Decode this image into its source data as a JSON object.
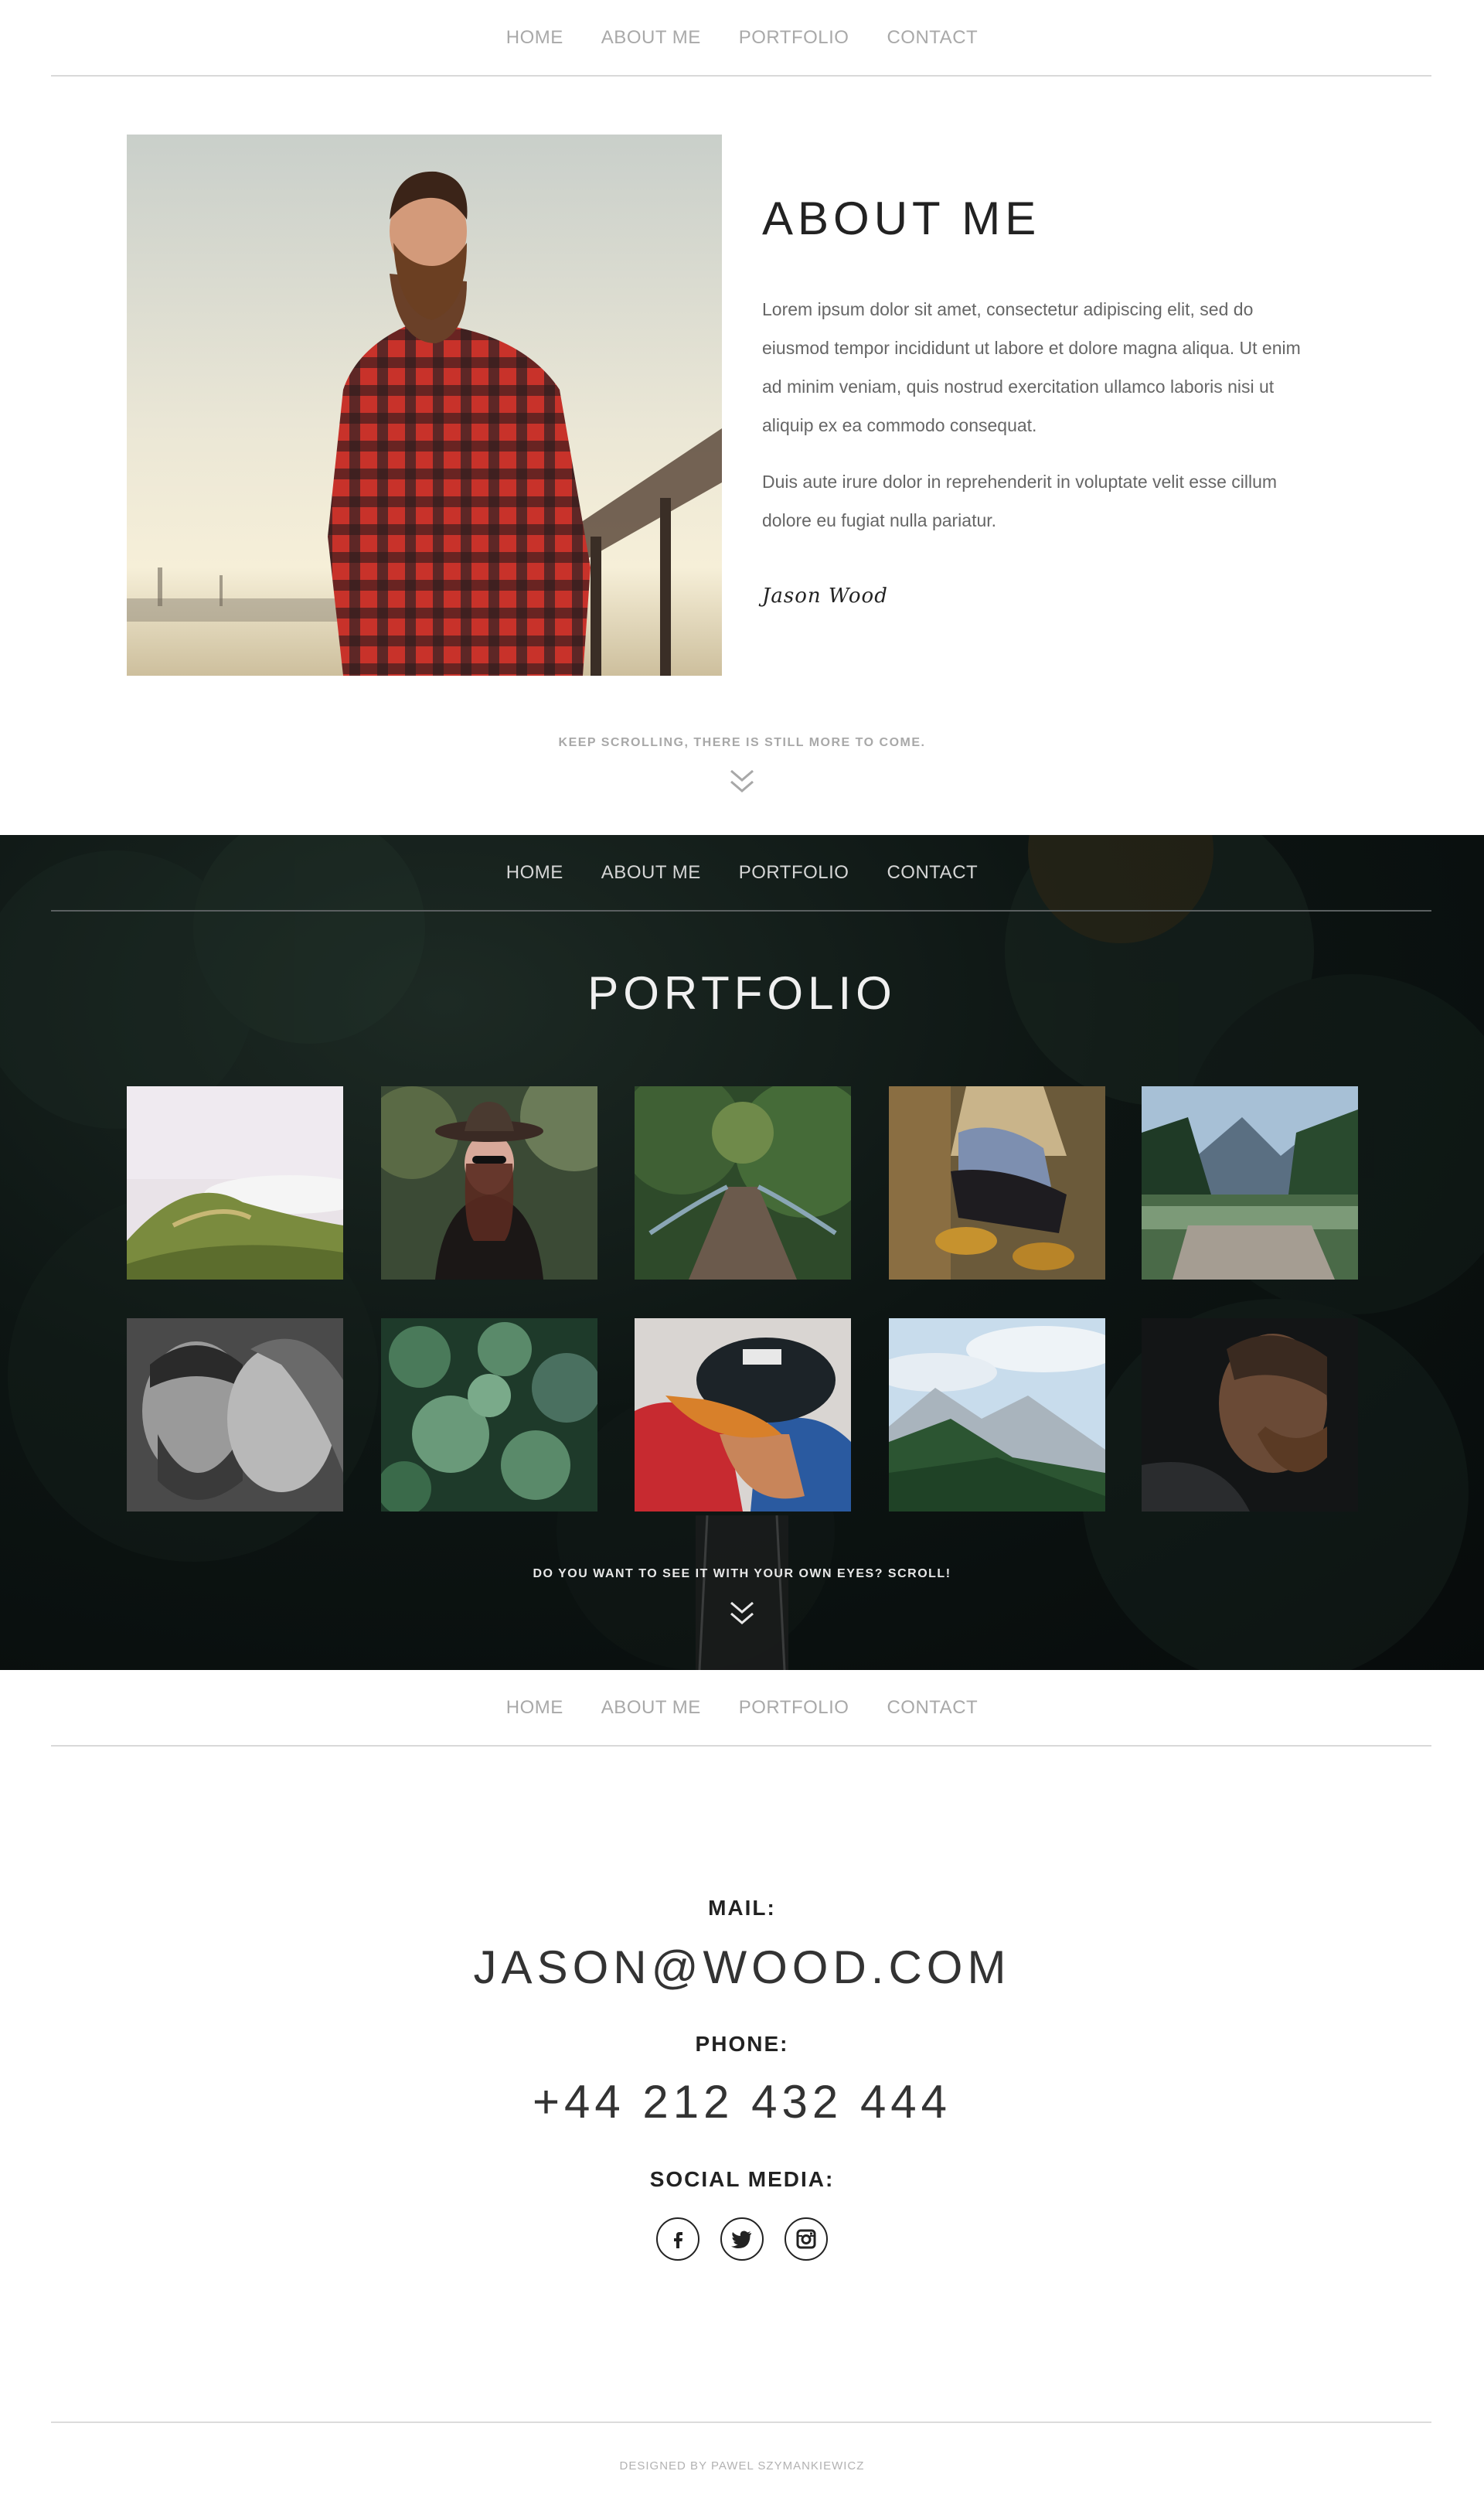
{
  "nav": {
    "items": [
      "HOME",
      "ABOUT ME",
      "PORTFOLIO",
      "CONTACT"
    ]
  },
  "about": {
    "title": "ABOUT ME",
    "paragraph_1": "Lorem ipsum dolor sit amet, consectetur adipiscing elit, sed do eiusmod tempor incididunt ut labore et dolore magna aliqua. Ut enim ad minim veniam, quis nostrud exercitation ullamco laboris nisi ut aliquip ex ea commodo consequat.",
    "paragraph_2": "Duis aute irure dolor in reprehenderit in voluptate velit esse cillum dolore eu fugiat nulla pariatur.",
    "signature": "Jason Wood",
    "scroll_hint": "KEEP SCROLLING, THERE IS STILL MORE TO COME."
  },
  "portfolio": {
    "title": "PORTFOLIO",
    "scroll_hint": "DO YOU WANT TO SEE IT WITH YOUR OWN EYES? SCROLL!",
    "thumbnails": [
      "hills-in-fog",
      "woman-in-hat",
      "forest-bridge",
      "seated-hiker-boots",
      "mountain-lake-pier",
      "couple-black-white",
      "succulent-plants",
      "man-in-cap",
      "forested-mountains",
      "bearded-man-profile"
    ]
  },
  "contact": {
    "mail_label": "MAIL:",
    "mail_value": "JASON@WOOD.COM",
    "phone_label": "PHONE:",
    "phone_value": "+44 212 432 444",
    "social_label": "SOCIAL MEDIA:",
    "social_icons": [
      "facebook-icon",
      "twitter-icon",
      "instagram-icon"
    ]
  },
  "footer": {
    "credit": "DESIGNED BY PAWEL SZYMANKIEWICZ"
  },
  "colors": {
    "text_dark": "#222222",
    "nav_light": "#a9a9a9",
    "nav_dark": "#d6d6d6",
    "body_text": "#666666",
    "portfolio_bg": "#0d1513"
  }
}
